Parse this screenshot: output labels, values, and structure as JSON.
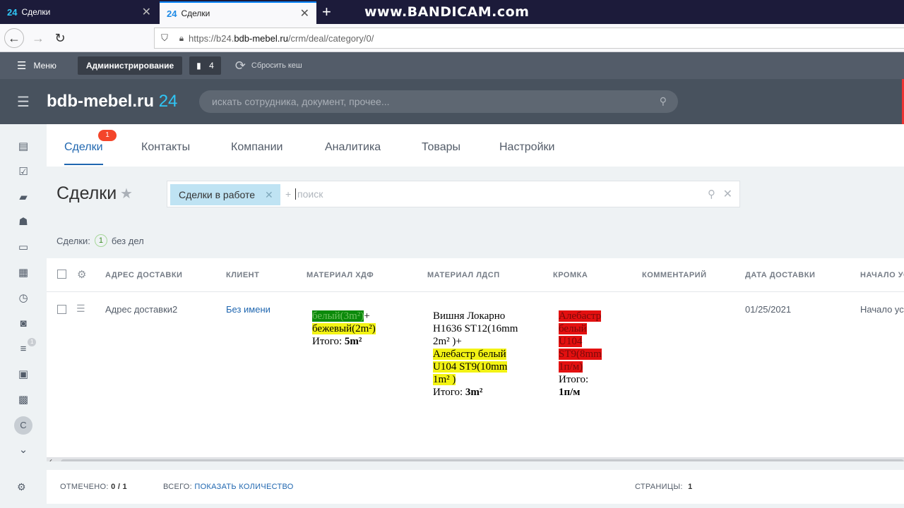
{
  "browser": {
    "tabs": [
      {
        "favicon": "24",
        "title": "Сделки",
        "active": false
      },
      {
        "favicon": "24",
        "title": "Сделки",
        "active": true
      }
    ],
    "watermark": "www.BANDICAM.com",
    "url": {
      "prefix": "https://b24.",
      "domain": "bdb-mebel.ru",
      "path": "/crm/deal/category/0/"
    }
  },
  "admin": {
    "menu_label": "Меню",
    "admin_button": "Администрирование",
    "notifications_count": "4",
    "reset_cache": "Сбросить кеш"
  },
  "header": {
    "logo_name": "bdb-mebel.ru",
    "logo_num": "24",
    "search_placeholder": "искать сотрудника, документ, прочее..."
  },
  "sidebar": {
    "filter_badge": "1",
    "user_initial": "С"
  },
  "topmenu": {
    "items": [
      "Сделки",
      "Контакты",
      "Компании",
      "Аналитика",
      "Товары",
      "Настройки"
    ],
    "active_badge": "1"
  },
  "page": {
    "title": "Сделки",
    "filter_preset": "Сделки в работе",
    "filter_plus": "+",
    "filter_placeholder": "поиск"
  },
  "counter": {
    "label": "Сделки:",
    "count": "1",
    "suffix": "без дел"
  },
  "grid": {
    "columns": [
      "АДРЕС ДОСТАВКИ",
      "КЛИЕНТ",
      "МАТЕРИАЛ ХДФ",
      "МАТЕРИАЛ ЛДСП",
      "КРОМКА",
      "КОММЕНТАРИЙ",
      "ДАТА ДОСТАВКИ",
      "НАЧАЛО УС"
    ],
    "row": {
      "address": "Адрес доставки2",
      "client": "Без имени",
      "hdf": {
        "line1_hl": "белый(3m²)",
        "line1_rest": "+",
        "line2_hl": "бежевый(2m²)",
        "total_label": "Итого: ",
        "total_value": "5m²"
      },
      "ldsp": {
        "line1": "Вишня Локарно",
        "line2": "H1636 ST12(16mm",
        "line3": "2m² )+",
        "hl1": "Алебастр белый",
        "hl2": "U104 ST9(10mm",
        "hl3": "1m² )",
        "total_label": "Итого: ",
        "total_value": "3m²"
      },
      "edge": {
        "hl1": "Алебастр",
        "hl2": "белый",
        "hl3": "U104",
        "hl4": "ST9(8mm",
        "hl5": "1п/м)",
        "total_label": "Итого:",
        "total_value": "1п/м"
      },
      "comment": "",
      "delivery_date": "01/25/2021",
      "start": "Начало ус"
    }
  },
  "footer": {
    "marked_label": "ОТМЕЧЕНО:",
    "marked_value": "0 / 1",
    "total_label": "ВСЕГО:",
    "total_link": "ПОКАЗАТЬ КОЛИЧЕСТВО",
    "pages_label": "СТРАНИЦЫ:",
    "pages_value": "1"
  }
}
